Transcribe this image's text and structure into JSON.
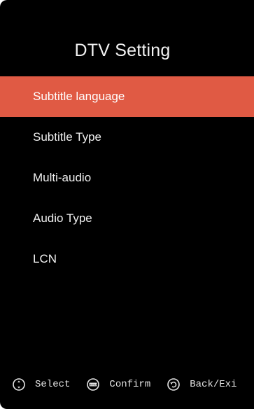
{
  "title": "DTV Setting",
  "menu": {
    "items": [
      {
        "label": "Subtitle language",
        "selected": true
      },
      {
        "label": "Subtitle Type",
        "selected": false
      },
      {
        "label": "Multi-audio",
        "selected": false
      },
      {
        "label": "Audio Type",
        "selected": false
      },
      {
        "label": "LCN",
        "selected": false
      }
    ]
  },
  "footer": {
    "hints": [
      {
        "icon": "dpad-icon",
        "label": "Select"
      },
      {
        "icon": "enter-icon",
        "label": "Confirm",
        "icon_text": "ENTER"
      },
      {
        "icon": "back-icon",
        "label": "Back/Exi"
      }
    ]
  },
  "colors": {
    "background": "#000000",
    "highlight": "#e05a44",
    "text": "#f0f0f0"
  }
}
